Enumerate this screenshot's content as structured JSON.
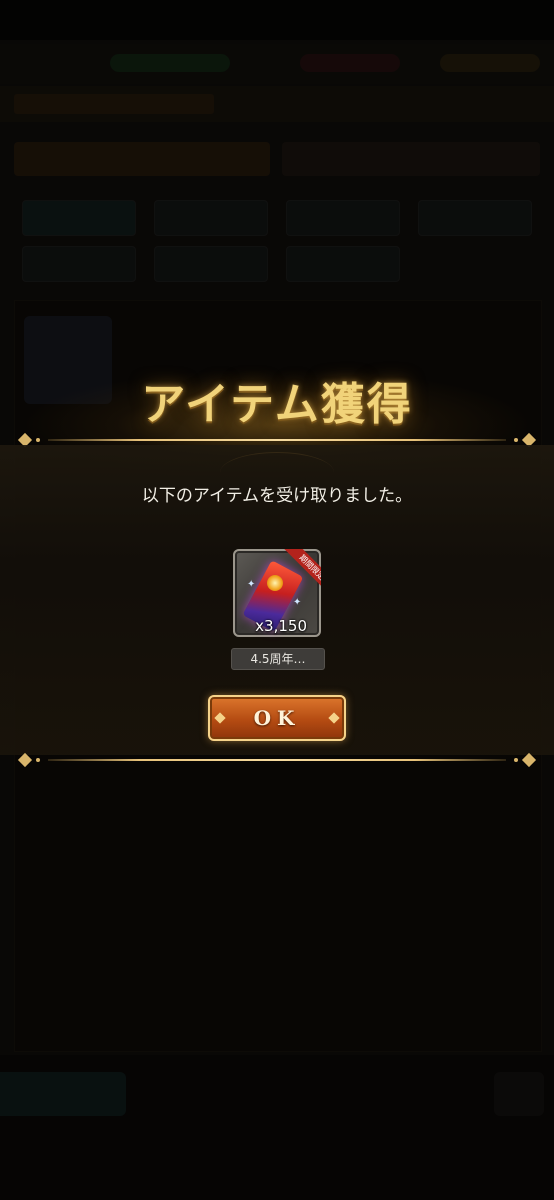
{
  "dialog": {
    "title": "アイテム獲得",
    "message": "以下のアイテムを受け取りました。",
    "item": {
      "quantity": "x3,150",
      "name": "4.5周年…",
      "badge": "期間限定",
      "icon": "ticket-icon"
    },
    "ok_label": "OK"
  },
  "colors": {
    "title_gold": "#f1d37a",
    "button_orange": "#c8561a",
    "overlay": "#000000"
  }
}
